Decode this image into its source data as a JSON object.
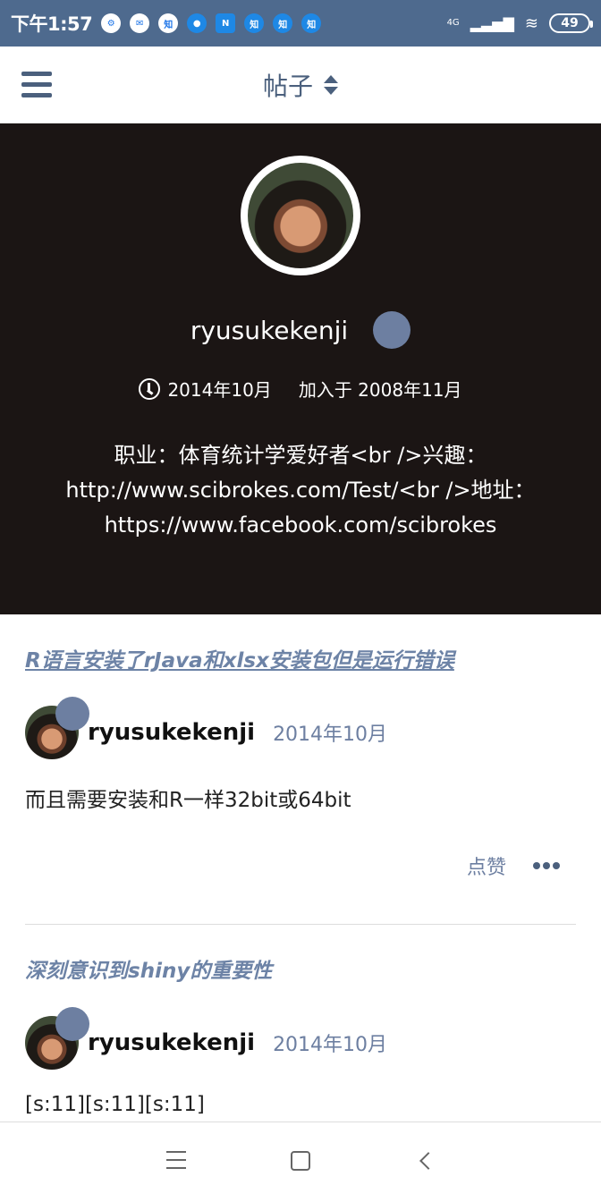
{
  "status_bar": {
    "time": "下午1:57",
    "network": "4G",
    "battery": "49",
    "notif_zhi": "知",
    "notif_n": "N"
  },
  "header": {
    "title": "帖子"
  },
  "profile": {
    "username": "ryusukekenji",
    "last_active": "2014年10月",
    "joined": "加入于 2008年11月",
    "bio_lines": [
      "职业：体育统计学爱好者<br />兴趣：",
      "http://www.scibrokes.com/Test/<br />地址：",
      "https://www.facebook.com/scibrokes"
    ]
  },
  "posts": [
    {
      "title": "R语言安装了rJava和xlsx安装包但是运行错误",
      "author": "ryusukekenji",
      "date": "2014年10月",
      "body": "而且需要安装和R一样32bit或64bit",
      "like_label": "点赞"
    },
    {
      "title": "深刻意识到shiny的重要性",
      "author": "ryusukekenji",
      "date": "2014年10月",
      "body": "[s:11][s:11][s:11]"
    }
  ],
  "colors": {
    "status_bar": "#4e6a8e",
    "hero_bg": "#1b1514",
    "accent": "#6d83a6",
    "status_dot": "#6d7fa1"
  }
}
